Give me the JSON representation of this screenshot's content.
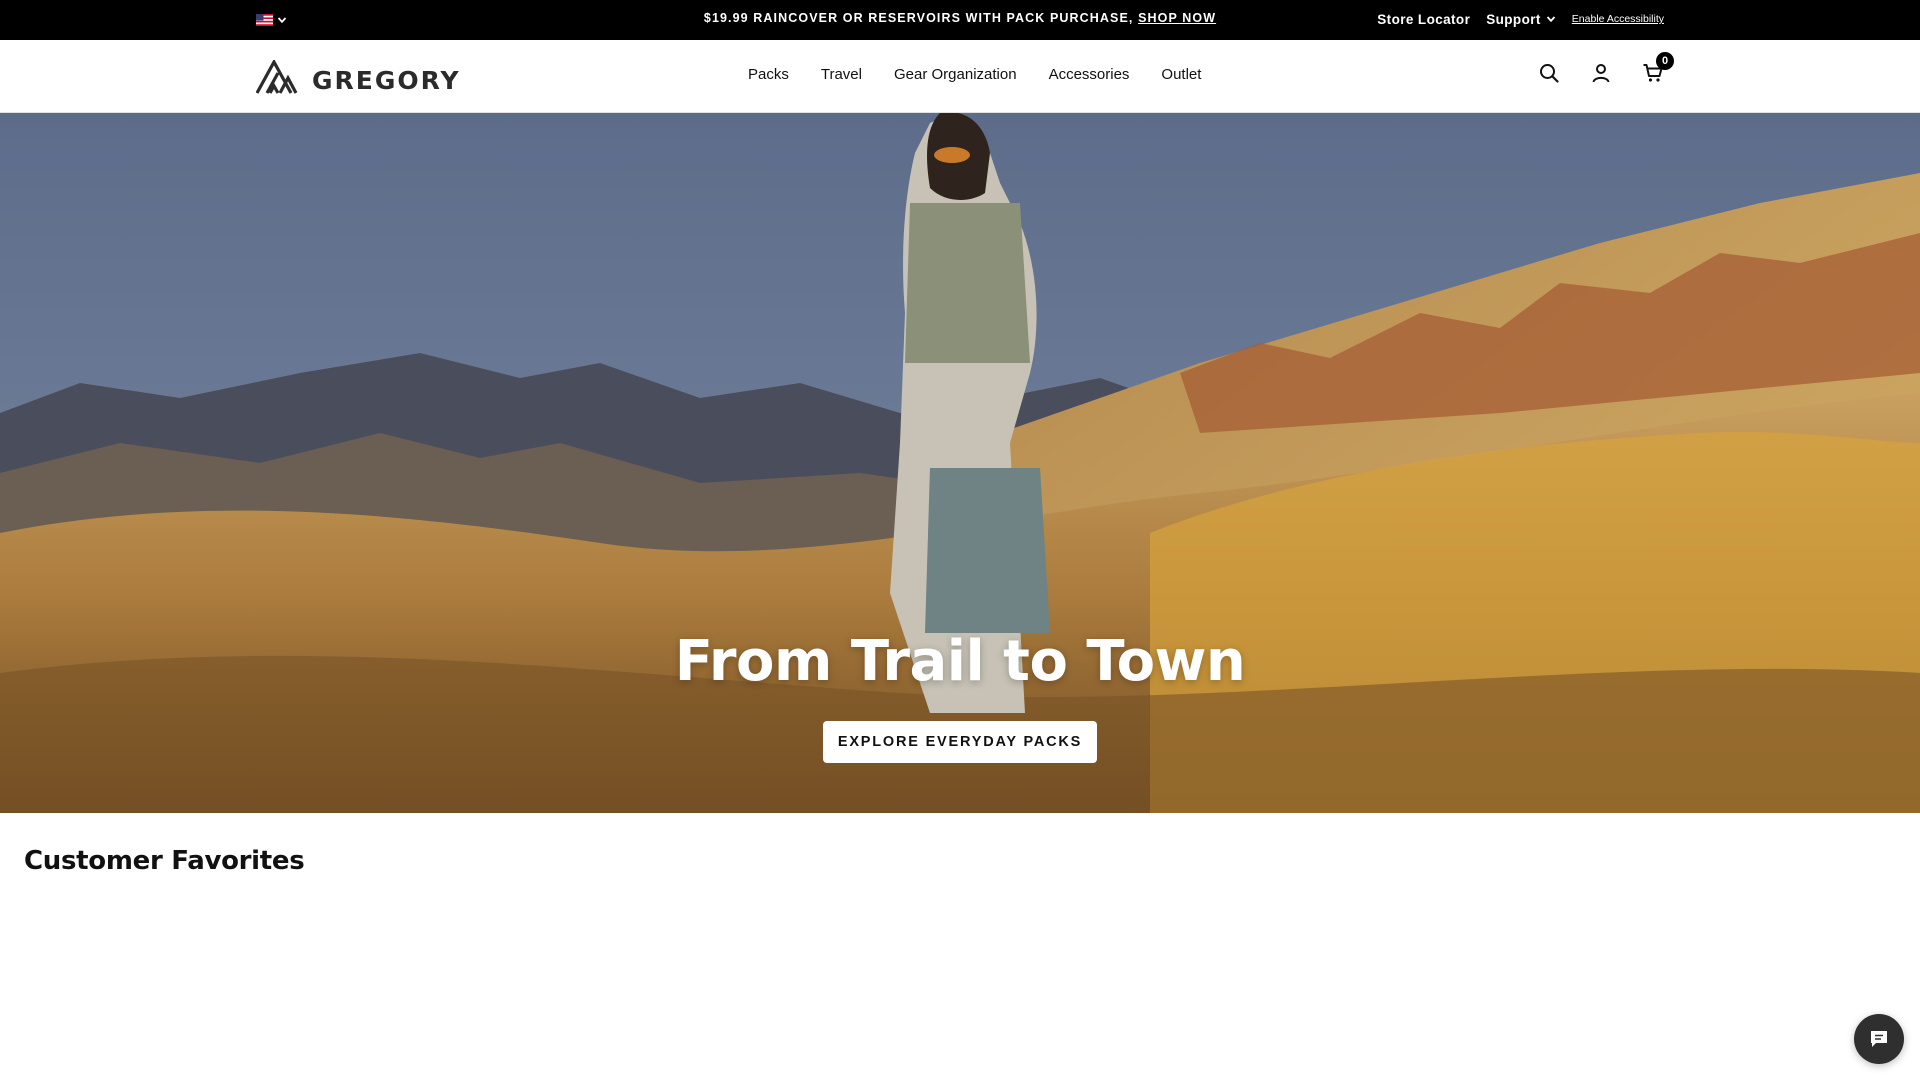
{
  "topbar": {
    "locale_icon": "us-flag-icon",
    "promo_text": "$19.99 RAINCOVER OR RESERVOIRS WITH PACK PURCHASE,",
    "promo_link": "SHOP NOW",
    "store_locator": "Store Locator",
    "support": "Support",
    "accessibility": "Enable Accessibility"
  },
  "header": {
    "logo_text": "GREGORY",
    "nav": [
      {
        "label": "Packs"
      },
      {
        "label": "Travel"
      },
      {
        "label": "Gear Organization"
      },
      {
        "label": "Accessories"
      },
      {
        "label": "Outlet"
      }
    ],
    "icons": [
      "search-icon",
      "account-icon",
      "cart-icon"
    ],
    "cart_count": "0"
  },
  "hero": {
    "title": "From Trail to Town",
    "cta": "EXPLORE EVERYDAY PACKS"
  },
  "favorites": {
    "title": "Customer Favorites"
  },
  "chat": {
    "icon": "chat-icon"
  },
  "colors": {
    "topbar_bg": "#000000",
    "header_bg": "#ffffff",
    "text": "#111111",
    "sky": "#5e6f8f",
    "grass": "#c99a4a"
  }
}
